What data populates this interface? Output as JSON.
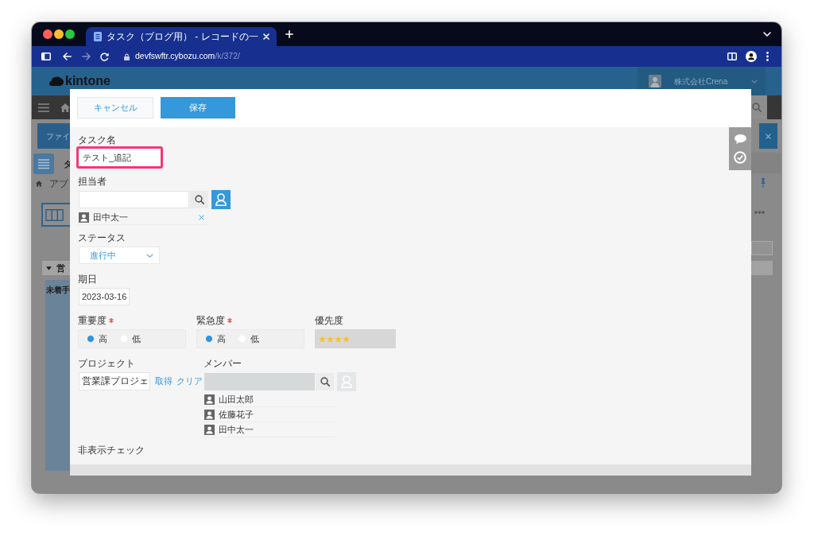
{
  "browser": {
    "tab_title": "タスク（ブログ用） - レコードの一",
    "url_host": "devfswftr.cybozu.com",
    "url_path": "/k/372/"
  },
  "app": {
    "logo": "kintone",
    "account": "株式会社Crena",
    "file_button": "ファイ",
    "app_name": "タ",
    "breadcrumb": "アプ",
    "group": "営",
    "column": "未着手"
  },
  "dialog": {
    "buttons": [
      {
        "kind": "cancel",
        "label": "キャンセル"
      },
      {
        "kind": "save",
        "label": "保存"
      }
    ],
    "rows": [
      {
        "fields": [
          {
            "kind": "text",
            "label": "タスク名",
            "required": false,
            "highlighted": true,
            "value": "テスト_追記"
          }
        ]
      },
      {
        "fields": [
          {
            "kind": "user",
            "label": "担当者",
            "required": false,
            "highlighted": false,
            "disabled": false,
            "users": [
              "田中太一"
            ]
          }
        ]
      },
      {
        "fields": [
          {
            "kind": "dropdown",
            "label": "ステータス",
            "required": false,
            "highlighted": false,
            "value": "進行中"
          }
        ]
      },
      {
        "fields": [
          {
            "kind": "date",
            "label": "期日",
            "required": false,
            "highlighted": false,
            "value": "2023-03-16"
          }
        ]
      },
      {
        "fields": [
          {
            "kind": "radio",
            "label": "重要度",
            "required": true,
            "highlighted": false,
            "options": [
              {
                "label": "高",
                "selected": true
              },
              {
                "label": "低",
                "selected": false
              }
            ]
          },
          {
            "kind": "radio",
            "label": "緊急度",
            "required": true,
            "highlighted": false,
            "options": [
              {
                "label": "高",
                "selected": true
              },
              {
                "label": "低",
                "selected": false
              }
            ]
          },
          {
            "kind": "stars",
            "label": "優先度",
            "required": false,
            "highlighted": false,
            "stars": 4
          }
        ]
      },
      {
        "fields": [
          {
            "kind": "lookup",
            "label": "プロジェクト",
            "required": false,
            "highlighted": false,
            "value": "営業課プロジェ",
            "actions": [
              "取得",
              "クリア"
            ]
          },
          {
            "kind": "user",
            "label": "メンバー",
            "required": false,
            "highlighted": false,
            "disabled": true,
            "users": [
              "山田太郎",
              "佐藤花子",
              "田中太一"
            ]
          }
        ]
      },
      {
        "fields": [
          {
            "kind": "checkbox",
            "label": "非表示チェック",
            "required": false,
            "highlighted": false
          }
        ]
      }
    ]
  }
}
